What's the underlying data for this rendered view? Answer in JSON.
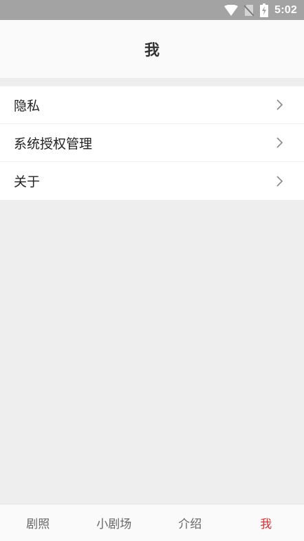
{
  "status_bar": {
    "time": "5:02",
    "icons": [
      "wifi-icon",
      "no-sim-icon",
      "battery-charging-icon"
    ]
  },
  "header": {
    "title": "我"
  },
  "settings": {
    "items": [
      {
        "label": "隐私",
        "icon": "chevron-right-icon"
      },
      {
        "label": "系统授权管理",
        "icon": "chevron-right-icon"
      },
      {
        "label": "关于",
        "icon": "chevron-right-icon"
      }
    ]
  },
  "tab_bar": {
    "active_color": "#e52f33",
    "tabs": [
      {
        "label": "剧照"
      },
      {
        "label": "小剧场"
      },
      {
        "label": "介绍"
      },
      {
        "label": "我",
        "active": true
      }
    ]
  }
}
